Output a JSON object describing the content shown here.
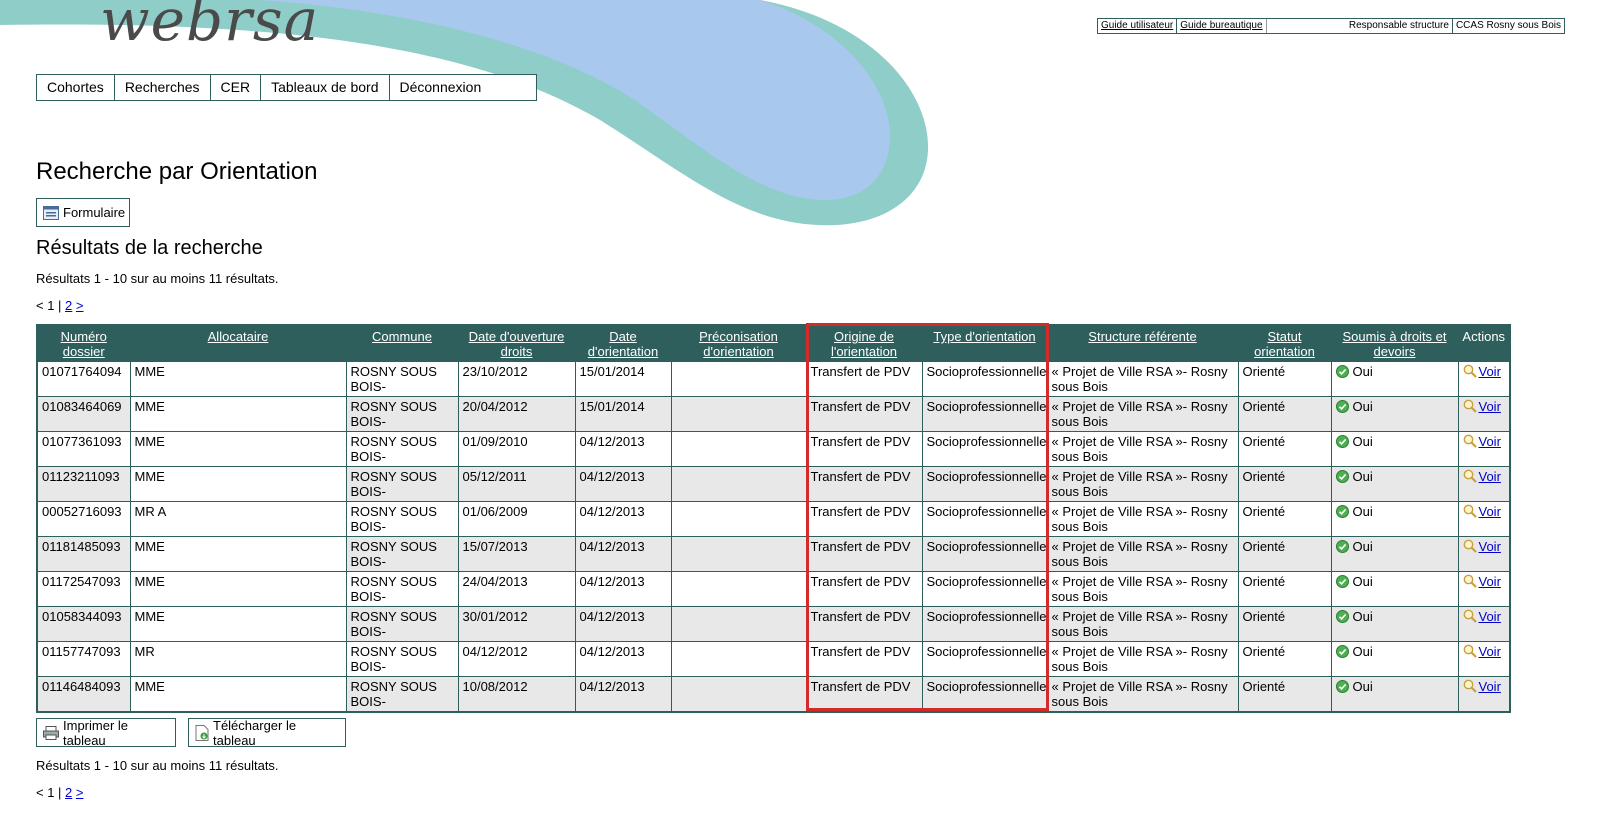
{
  "app": {
    "logo": "webrsa"
  },
  "topbar": {
    "guide_user": "Guide utilisateur",
    "guide_office": "Guide bureautique",
    "role": "Responsable structure",
    "structure": "CCAS Rosny sous Bois"
  },
  "menu": [
    "Cohortes",
    "Recherches",
    "CER",
    "Tableaux de bord",
    "Déconnexion"
  ],
  "page_title": "Recherche par Orientation",
  "form_button": "Formulaire",
  "results_title": "Résultats de la recherche",
  "results_info": "Résultats 1 - 10 sur au moins 11 résultats.",
  "pager": {
    "prefix": "< 1 | ",
    "page2": "2",
    "next": ">"
  },
  "table": {
    "headers": [
      "Numéro dossier",
      "Allocataire",
      "Commune",
      "Date d'ouverture droits",
      "Date d'orientation",
      "Préconisation d'orientation",
      "Origine de l'orientation",
      "Type d'orientation",
      "Structure référente",
      "Statut orientation",
      "Soumis à droits et devoirs",
      "Actions"
    ],
    "rows": [
      {
        "num": "01071764094",
        "alloc": "MME",
        "commune": "ROSNY SOUS BOIS-",
        "ouverture": "23/10/2012",
        "date_or": "15/01/2014",
        "precon": "",
        "origine": "Transfert de PDV",
        "type": "Socioprofessionnelle",
        "structure": "« Projet de Ville RSA »- Rosny sous Bois",
        "statut": "Orienté",
        "soumis": "Oui",
        "action": "Voir"
      },
      {
        "num": "01083464069",
        "alloc": "MME",
        "commune": "ROSNY SOUS BOIS-",
        "ouverture": "20/04/2012",
        "date_or": "15/01/2014",
        "precon": "",
        "origine": "Transfert de PDV",
        "type": "Socioprofessionnelle",
        "structure": "« Projet de Ville RSA »- Rosny sous Bois",
        "statut": "Orienté",
        "soumis": "Oui",
        "action": "Voir"
      },
      {
        "num": "01077361093",
        "alloc": "MME",
        "commune": "ROSNY SOUS BOIS-",
        "ouverture": "01/09/2010",
        "date_or": "04/12/2013",
        "precon": "",
        "origine": "Transfert de PDV",
        "type": "Socioprofessionnelle",
        "structure": "« Projet de Ville RSA »- Rosny sous Bois",
        "statut": "Orienté",
        "soumis": "Oui",
        "action": "Voir"
      },
      {
        "num": "01123211093",
        "alloc": "MME",
        "commune": "ROSNY SOUS BOIS-",
        "ouverture": "05/12/2011",
        "date_or": "04/12/2013",
        "precon": "",
        "origine": "Transfert de PDV",
        "type": "Socioprofessionnelle",
        "structure": "« Projet de Ville RSA »- Rosny sous Bois",
        "statut": "Orienté",
        "soumis": "Oui",
        "action": "Voir"
      },
      {
        "num": "00052716093",
        "alloc": "MR A",
        "commune": "ROSNY SOUS BOIS-",
        "ouverture": "01/06/2009",
        "date_or": "04/12/2013",
        "precon": "",
        "origine": "Transfert de PDV",
        "type": "Socioprofessionnelle",
        "structure": "« Projet de Ville RSA »- Rosny sous Bois",
        "statut": "Orienté",
        "soumis": "Oui",
        "action": "Voir"
      },
      {
        "num": "01181485093",
        "alloc": "MME",
        "commune": "ROSNY SOUS BOIS-",
        "ouverture": "15/07/2013",
        "date_or": "04/12/2013",
        "precon": "",
        "origine": "Transfert de PDV",
        "type": "Socioprofessionnelle",
        "structure": "« Projet de Ville RSA »- Rosny sous Bois",
        "statut": "Orienté",
        "soumis": "Oui",
        "action": "Voir"
      },
      {
        "num": "01172547093",
        "alloc": "MME",
        "commune": "ROSNY SOUS BOIS-",
        "ouverture": "24/04/2013",
        "date_or": "04/12/2013",
        "precon": "",
        "origine": "Transfert de PDV",
        "type": "Socioprofessionnelle",
        "structure": "« Projet de Ville RSA »- Rosny sous Bois",
        "statut": "Orienté",
        "soumis": "Oui",
        "action": "Voir"
      },
      {
        "num": "01058344093",
        "alloc": "MME",
        "commune": "ROSNY SOUS BOIS-",
        "ouverture": "30/01/2012",
        "date_or": "04/12/2013",
        "precon": "",
        "origine": "Transfert de PDV",
        "type": "Socioprofessionnelle",
        "structure": "« Projet de Ville RSA »- Rosny sous Bois",
        "statut": "Orienté",
        "soumis": "Oui",
        "action": "Voir"
      },
      {
        "num": "01157747093",
        "alloc": "MR",
        "commune": "ROSNY SOUS BOIS-",
        "ouverture": "04/12/2012",
        "date_or": "04/12/2013",
        "precon": "",
        "origine": "Transfert de PDV",
        "type": "Socioprofessionnelle",
        "structure": "« Projet de Ville RSA »- Rosny sous Bois",
        "statut": "Orienté",
        "soumis": "Oui",
        "action": "Voir"
      },
      {
        "num": "01146484093",
        "alloc": "MME",
        "commune": "ROSNY SOUS BOIS-",
        "ouverture": "10/08/2012",
        "date_or": "04/12/2013",
        "precon": "",
        "origine": "Transfert de PDV",
        "type": "Socioprofessionnelle",
        "structure": "« Projet de Ville RSA »- Rosny sous Bois",
        "statut": "Orienté",
        "soumis": "Oui",
        "action": "Voir"
      }
    ]
  },
  "print_button": "Imprimer le tableau",
  "download_button": "Télécharger le tableau",
  "colors": {
    "header_bg": "#2e5f5d",
    "highlight": "#d42a2a",
    "swoosh_teal": "#8ecdc8",
    "swoosh_blue": "#a8c8ee"
  }
}
